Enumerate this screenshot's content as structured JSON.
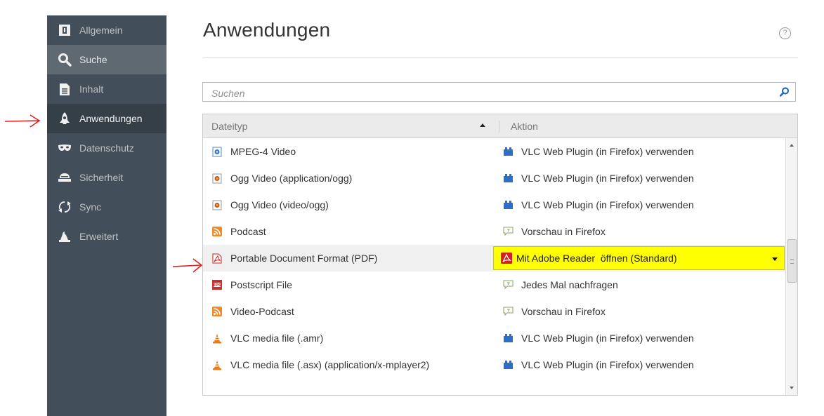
{
  "sidebar": {
    "items": [
      {
        "label": "Allgemein",
        "icon": "general-icon"
      },
      {
        "label": "Suche",
        "icon": "search-icon"
      },
      {
        "label": "Inhalt",
        "icon": "content-icon"
      },
      {
        "label": "Anwendungen",
        "icon": "applications-icon"
      },
      {
        "label": "Datenschutz",
        "icon": "privacy-mask-icon"
      },
      {
        "label": "Sicherheit",
        "icon": "security-icon"
      },
      {
        "label": "Sync",
        "icon": "sync-icon"
      },
      {
        "label": "Erweitert",
        "icon": "advanced-icon"
      }
    ],
    "active_index": 3,
    "hover_index": 1
  },
  "header": {
    "title": "Anwendungen",
    "help_label": "?"
  },
  "search": {
    "placeholder": "Suchen",
    "value": ""
  },
  "table": {
    "columns": [
      "Dateityp",
      "Aktion"
    ],
    "sort_column": "Dateityp",
    "sort_direction": "ascending",
    "rows": [
      {
        "type": "MPEG-4 Video",
        "type_icon": "mpeg-video-icon",
        "action": "VLC Web Plugin (in Firefox) verwenden",
        "action_icon": "plugin-icon"
      },
      {
        "type": "Ogg Video (application/ogg)",
        "type_icon": "ogg-video-icon",
        "action": "VLC Web Plugin (in Firefox) verwenden",
        "action_icon": "plugin-icon"
      },
      {
        "type": "Ogg Video (video/ogg)",
        "type_icon": "ogg-video-icon",
        "action": "VLC Web Plugin (in Firefox) verwenden",
        "action_icon": "plugin-icon"
      },
      {
        "type": "Podcast",
        "type_icon": "rss-feed-icon",
        "action": "Vorschau in Firefox",
        "action_icon": "preview-bubble-icon"
      },
      {
        "type": "Portable Document Format (PDF)",
        "type_icon": "pdf-file-icon",
        "action": "Mit Adobe Reader  öffnen (Standard)",
        "action_icon": "adobe-reader-icon",
        "selected": true
      },
      {
        "type": "Postscript File",
        "type_icon": "eps-file-icon",
        "action": "Jedes Mal nachfragen",
        "action_icon": "ask-bubble-icon"
      },
      {
        "type": "Video-Podcast",
        "type_icon": "rss-feed-icon",
        "action": "Vorschau in Firefox",
        "action_icon": "preview-bubble-icon"
      },
      {
        "type": "VLC media file (.amr)",
        "type_icon": "vlc-cone-icon",
        "action": "VLC Web Plugin (in Firefox) verwenden",
        "action_icon": "plugin-icon"
      },
      {
        "type": "VLC media file (.asx) (application/x-mplayer2)",
        "type_icon": "vlc-cone-icon",
        "action": "VLC Web Plugin (in Firefox) verwenden",
        "action_icon": "plugin-icon"
      }
    ]
  },
  "colors": {
    "sidebar_bg": "#424f5a",
    "sidebar_active": "#343f48",
    "sidebar_hover": "#5e6972",
    "highlight": "#ffff00",
    "annotation_red": "#e02020",
    "plugin_blue": "#2a6fc9"
  }
}
